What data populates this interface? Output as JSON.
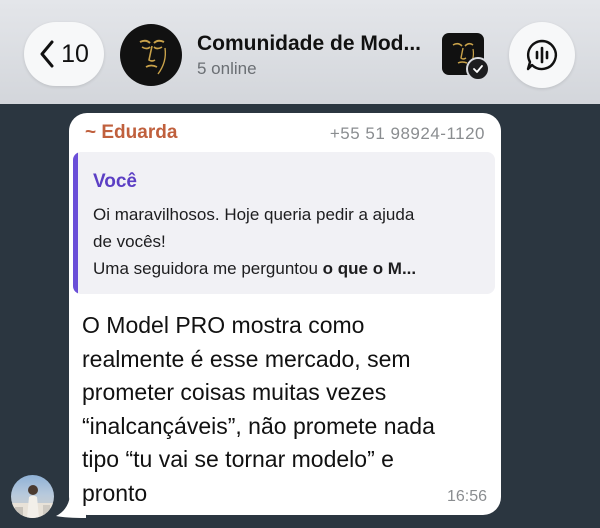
{
  "header": {
    "back_count": "10",
    "title": "Comunidade de Mod...",
    "subtitle": "5 online"
  },
  "message": {
    "sender": "~ Eduarda",
    "phone": "+55 51 98924-1120",
    "reply": {
      "author": "Você",
      "line1": "Oi maravilhosos. Hoje queria pedir a ajuda",
      "line2": "de vocês!",
      "line3_normal": "Uma seguidora me perguntou ",
      "line3_bold": "o que o M..."
    },
    "body_lines": [
      "O Model PRO mostra como",
      "realmente é esse mercado, sem",
      "prometer coisas muitas vezes",
      "“inalcançáveis”, não promete nada",
      "tipo “tu vai se tornar modelo” e",
      "pronto"
    ],
    "time": "16:56"
  },
  "colors": {
    "background": "#2b3640",
    "sender": "#c0603d",
    "reply_accent": "#6b4fd8",
    "bubble": "#ffffff"
  },
  "icons": [
    "chevron-left-icon",
    "group-avatar-face-logo",
    "verified-check-icon",
    "voice-chat-icon"
  ]
}
